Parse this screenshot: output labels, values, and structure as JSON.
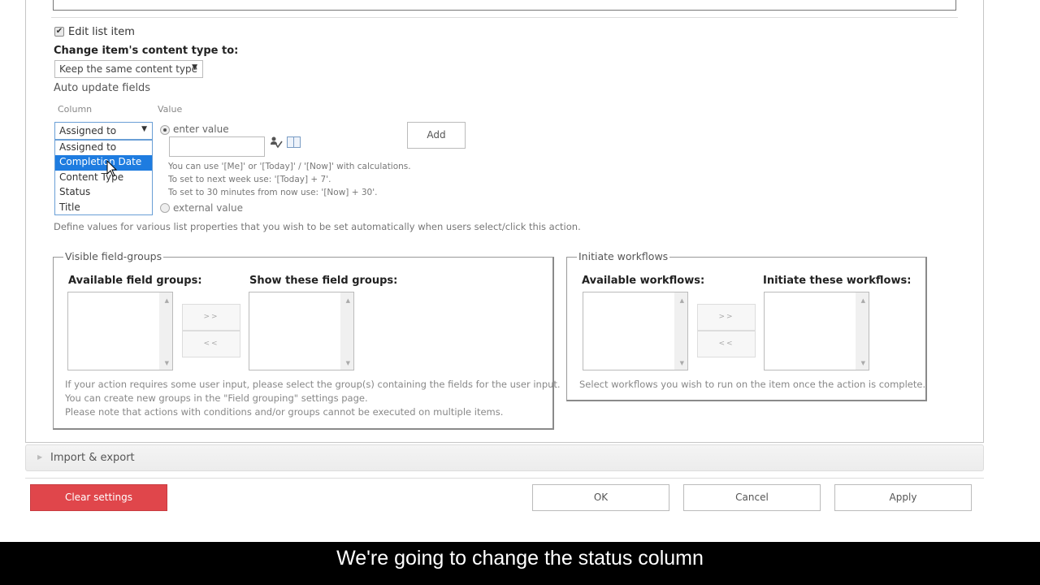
{
  "action": {
    "edit_list_item": {
      "label": "Edit list item",
      "checked": true
    },
    "content_type": {
      "label": "Change item's content type to:",
      "selected": "Keep the same content type"
    },
    "auto_update": {
      "label": "Auto update fields",
      "column_header": "Column",
      "value_header": "Value",
      "column_select": {
        "selected": "Assigned to",
        "options": [
          "Assigned to",
          "Completion Date",
          "Content Type",
          "Status",
          "Title"
        ],
        "highlighted": "Completion Date"
      },
      "enter_value_label": "enter value",
      "enter_value_checked": true,
      "value_input": "",
      "hints": [
        "You can use '[Me]' or '[Today]' / '[Now]' with calculations.",
        "To set to next week use: '[Today] + 7'.",
        "To set to 30 minutes from now use: '[Now] + 30'."
      ],
      "external_value_label": "external value",
      "add_button": "Add",
      "description": "Define values for various list properties that you wish to be set automatically when users select/click this action.",
      "icons": [
        "people-picker-icon",
        "lookup-book-icon"
      ]
    },
    "visible_field_groups": {
      "legend": "Visible field-groups",
      "available_label": "Available field groups:",
      "selected_label": "Show these field groups:",
      "move_right": ">>",
      "move_left": "<<",
      "notes": [
        "If your action requires some user input, please select the group(s) containing the fields for the user input.",
        "You can create new groups in the \"Field grouping\" settings page.",
        "Please note that actions with conditions and/or groups cannot be executed on multiple items."
      ]
    },
    "initiate_workflows": {
      "legend": "Initiate workflows",
      "available_label": "Available workflows:",
      "selected_label": "Initiate these workflows:",
      "move_right": ">>",
      "move_left": "<<",
      "note": "Select workflows you wish to run on the item once the action is complete."
    }
  },
  "import_export": {
    "label": "Import & export"
  },
  "footer": {
    "clear_settings": "Clear settings",
    "ok": "OK",
    "cancel": "Cancel",
    "apply": "Apply",
    "clear_color": "#e0464b"
  },
  "subtitle": "We're going to change the status column"
}
